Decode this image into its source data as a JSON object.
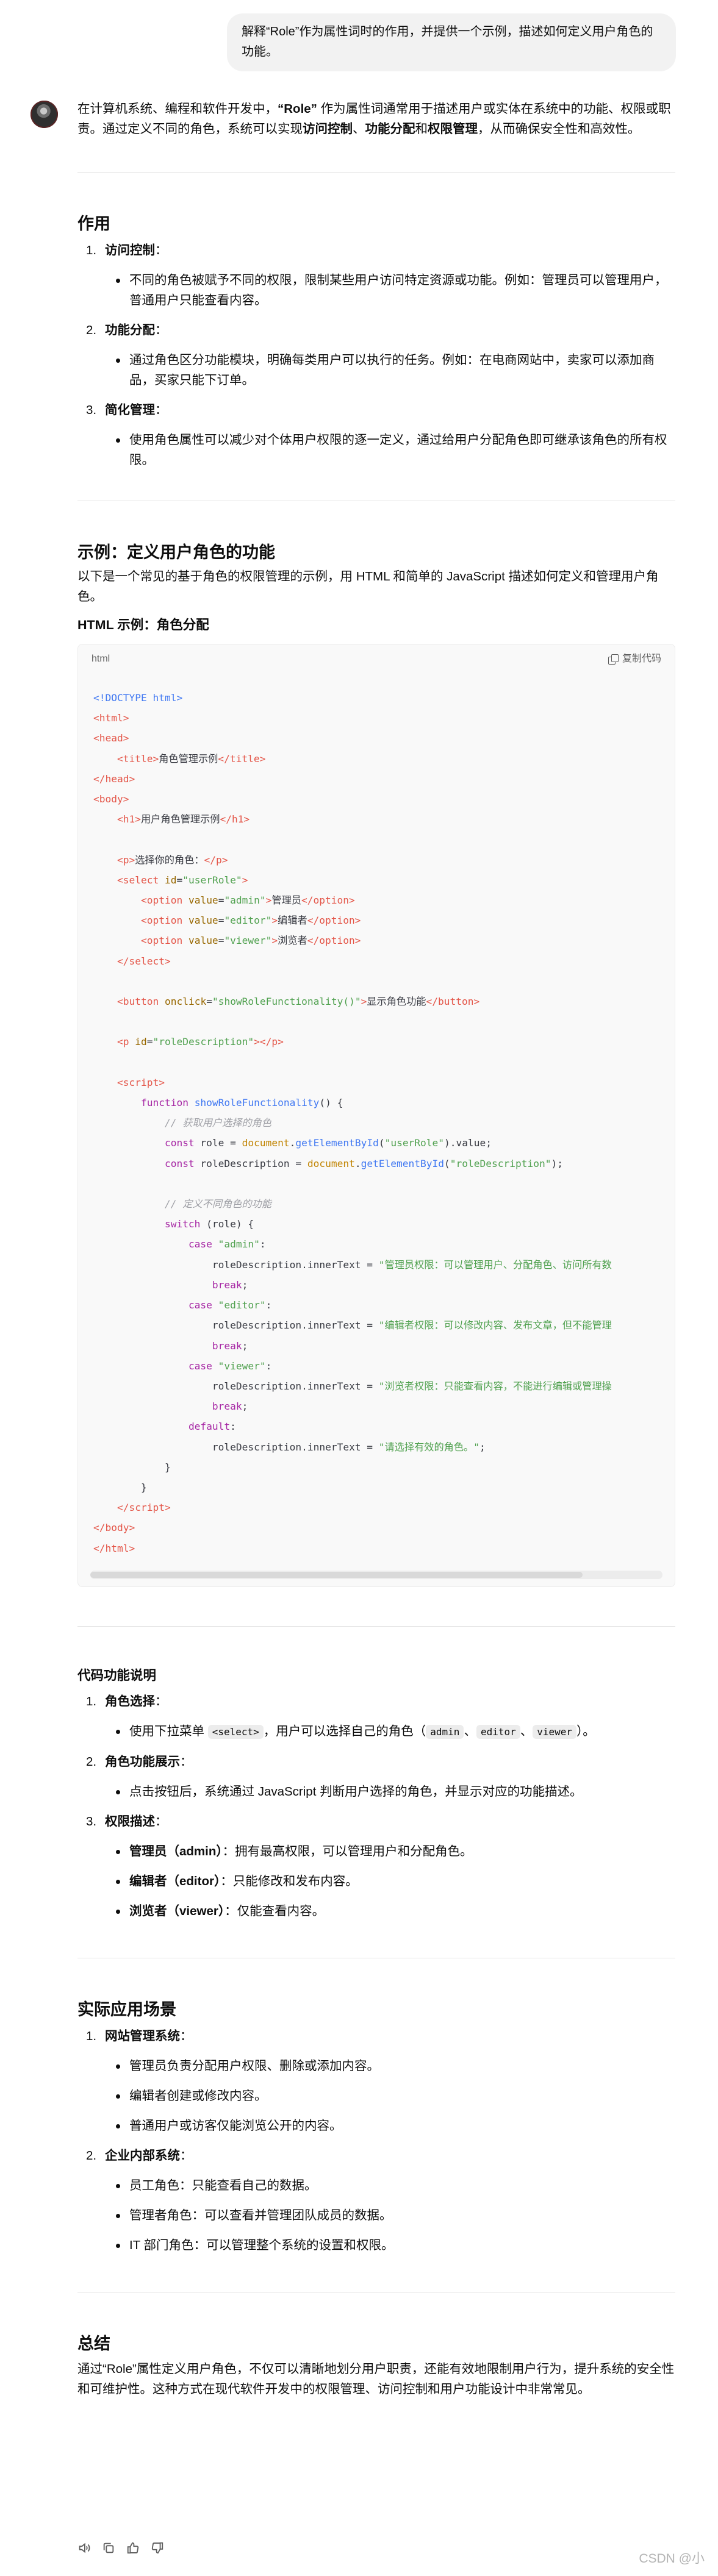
{
  "user_message": "解释“Role”作为属性词时的作用，并提供一个示例，描述如何定义用户角色的功能。",
  "intro": {
    "before": "在计算机系统、编程和软件开发中，",
    "term": "“Role”",
    "middle": " 作为属性词通常用于描述用户或实体在系统中的功能、权限或职责。通过定义不同的角色，系统可以实现",
    "b1": "访问控制",
    "sep1": "、",
    "b2": "功能分配",
    "sep2": "和",
    "b3": "权限管理",
    "after": "，从而确保安全性和高效性。"
  },
  "section_purpose": {
    "title": "作用",
    "items": [
      {
        "num": "1.",
        "label": "访问控制",
        "colon": "：",
        "bullets": [
          "不同的角色被赋予不同的权限，限制某些用户访问特定资源或功能。例如：管理员可以管理用户，普通用户只能查看内容。"
        ]
      },
      {
        "num": "2.",
        "label": "功能分配",
        "colon": "：",
        "bullets": [
          "通过角色区分功能模块，明确每类用户可以执行的任务。例如：在电商网站中，卖家可以添加商品，买家只能下订单。"
        ]
      },
      {
        "num": "3.",
        "label": "简化管理",
        "colon": "：",
        "bullets": [
          "使用角色属性可以减少对个体用户权限的逐一定义，通过给用户分配角色即可继承该角色的所有权限。"
        ]
      }
    ]
  },
  "section_example": {
    "title": "示例：定义用户角色的功能",
    "desc": "以下是一个常见的基于角色的权限管理的示例，用 HTML 和简单的 JavaScript 描述如何定义和管理用户角色。",
    "subtitle": "HTML 示例：角色分配",
    "code_lang": "html",
    "copy_label": "复制代码"
  },
  "section_explain": {
    "title": "代码功能说明",
    "item1": {
      "num": "1.",
      "label": "角色选择",
      "colon": "：",
      "b_pre": "使用下拉菜单 ",
      "code_select": "<select>",
      "b_mid": "，用户可以选择自己的角色（",
      "code_admin": "admin",
      "sep_a": "、",
      "code_editor": "editor",
      "sep_b": "、",
      "code_viewer": "viewer",
      "b_end": "）。"
    },
    "item2": {
      "num": "2.",
      "label": "角色功能展示",
      "colon": "：",
      "bullet": "点击按钮后，系统通过 JavaScript 判断用户选择的角色，并显示对应的功能描述。"
    },
    "item3": {
      "num": "3.",
      "label": "权限描述",
      "colon": "：",
      "bullets": [
        {
          "b": "管理员（admin）",
          "t": "：拥有最高权限，可以管理用户和分配角色。"
        },
        {
          "b": "编辑者（editor）",
          "t": "：只能修改和发布内容。"
        },
        {
          "b": "浏览者（viewer）",
          "t": "：仅能查看内容。"
        }
      ]
    }
  },
  "section_scenarios": {
    "title": "实际应用场景",
    "items": [
      {
        "num": "1.",
        "label": "网站管理系统",
        "colon": "：",
        "bullets": [
          "管理员负责分配用户权限、删除或添加内容。",
          "编辑者创建或修改内容。",
          "普通用户或访客仅能浏览公开的内容。"
        ]
      },
      {
        "num": "2.",
        "label": "企业内部系统",
        "colon": "：",
        "bullets": [
          "员工角色：只能查看自己的数据。",
          "管理者角色：可以查看并管理团队成员的数据。",
          "IT 部门角色：可以管理整个系统的设置和权限。"
        ]
      }
    ]
  },
  "section_summary": {
    "title": "总结",
    "text": "通过“Role”属性定义用户角色，不仅可以清晰地划分用户职责，还能有效地限制用户行为，提升系统的安全性和可维护性。这种方式在现代软件开发中的权限管理、访问控制和用户功能设计中非常常见。"
  },
  "watermark": "CSDN @小"
}
